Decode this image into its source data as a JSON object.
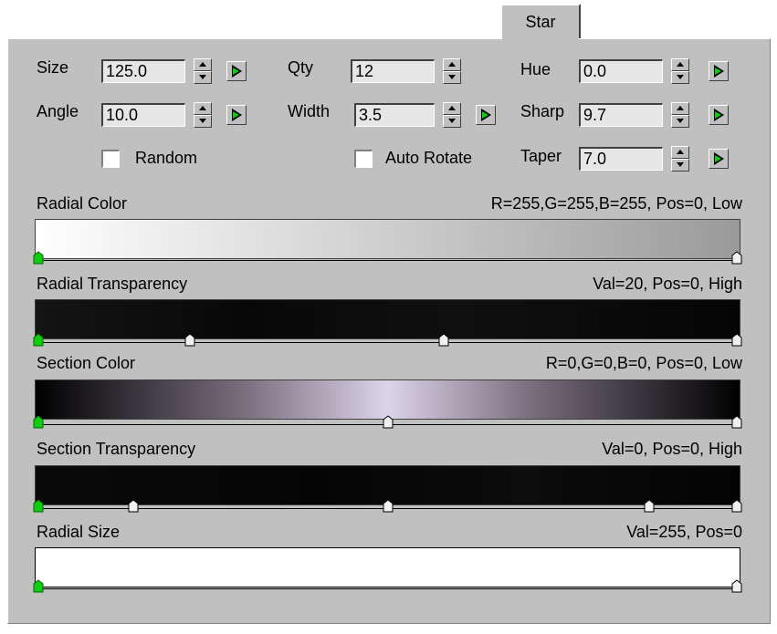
{
  "tab": {
    "label": "Star"
  },
  "controls": {
    "size": {
      "label": "Size",
      "value": "125.0"
    },
    "qty": {
      "label": "Qty",
      "value": "12"
    },
    "hue": {
      "label": "Hue",
      "value": "0.0"
    },
    "angle": {
      "label": "Angle",
      "value": "10.0"
    },
    "width": {
      "label": "Width",
      "value": "3.5"
    },
    "sharp": {
      "label": "Sharp",
      "value": "9.7"
    },
    "taper": {
      "label": "Taper",
      "value": "7.0"
    },
    "random": {
      "label": "Random",
      "checked": false
    },
    "auto_rotate": {
      "label": "Auto Rotate",
      "checked": false
    }
  },
  "gradients": [
    {
      "name": "radial-color",
      "label": "Radial Color",
      "status": "R=255,G=255,B=255, Pos=0, Low",
      "stops": [
        0,
        100
      ],
      "fill": "linear-gradient(to right,#ffffff 0%,#d8d8d8 40%,#9a9a9a 100%)"
    },
    {
      "name": "radial-transparency",
      "label": "Radial Transparency",
      "status": "Val=20, Pos=0, High",
      "stops": [
        0,
        22,
        58,
        100
      ],
      "fill": "linear-gradient(to right,#141414,#080808 30%,#101010 60%,#050505)"
    },
    {
      "name": "section-color",
      "label": "Section Color",
      "status": "R=0,G=0,B=0, Pos=0, Low",
      "stops": [
        0,
        50,
        100
      ],
      "fill": "linear-gradient(to right,#000000 0%,#7a7080 30%,#dcd4e8 50%,#7a7080 70%,#000000 100%)"
    },
    {
      "name": "section-transparency",
      "label": "Section Transparency",
      "status": "Val=0, Pos=0, High",
      "stops": [
        0,
        14,
        50,
        87,
        100
      ],
      "fill": "linear-gradient(to right,#0a0a0a,#050505 40%,#0c0c0c 70%,#030303)"
    },
    {
      "name": "radial-size",
      "label": "Radial Size",
      "status": "Val=255, Pos=0",
      "stops": [
        0,
        100
      ],
      "fill": "#ffffff"
    }
  ]
}
